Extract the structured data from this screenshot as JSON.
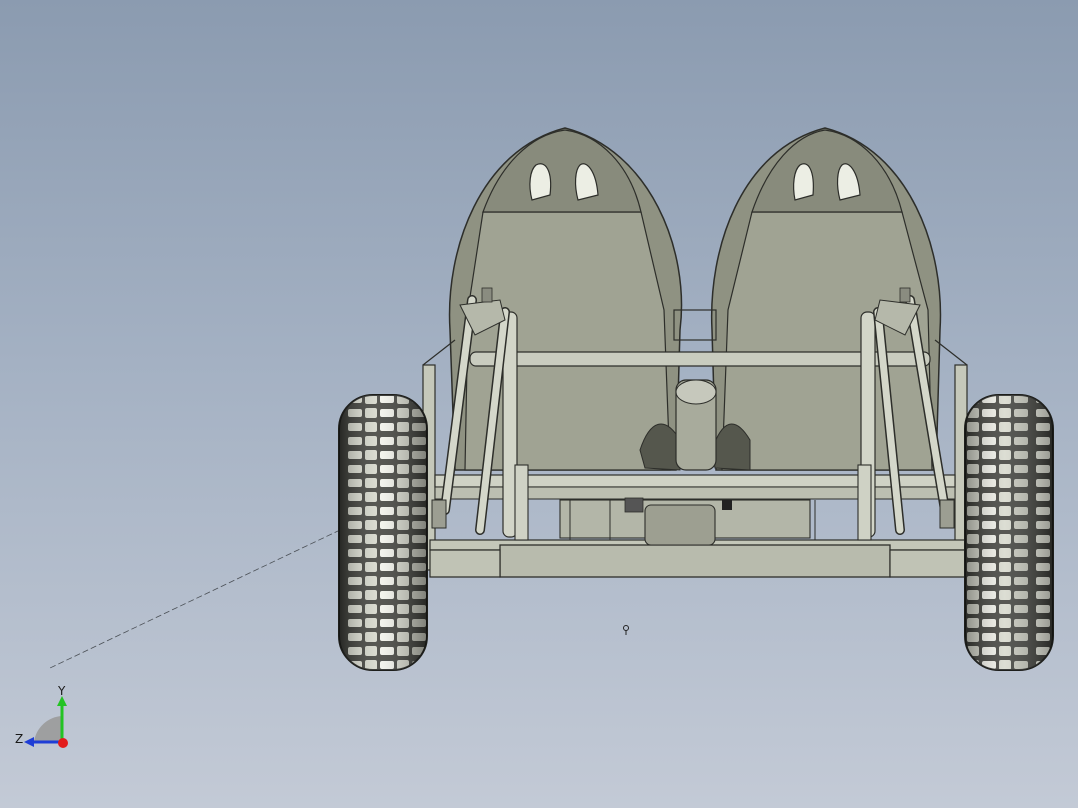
{
  "viewport": {
    "background_top": "#8b9bb0",
    "background_bottom": "#c3cad6"
  },
  "model": {
    "shell_color": "#8f9282",
    "shell_shade": "#6f7263",
    "frame_color": "#b9bcae",
    "tire_color": "#3a3b36",
    "tread_color": "#e2e4d8"
  },
  "triad": {
    "y_label": "Y",
    "z_label": "Z",
    "y_color": "#23c323",
    "z_color": "#1f3ed6",
    "x_color": "#e21b1b"
  }
}
